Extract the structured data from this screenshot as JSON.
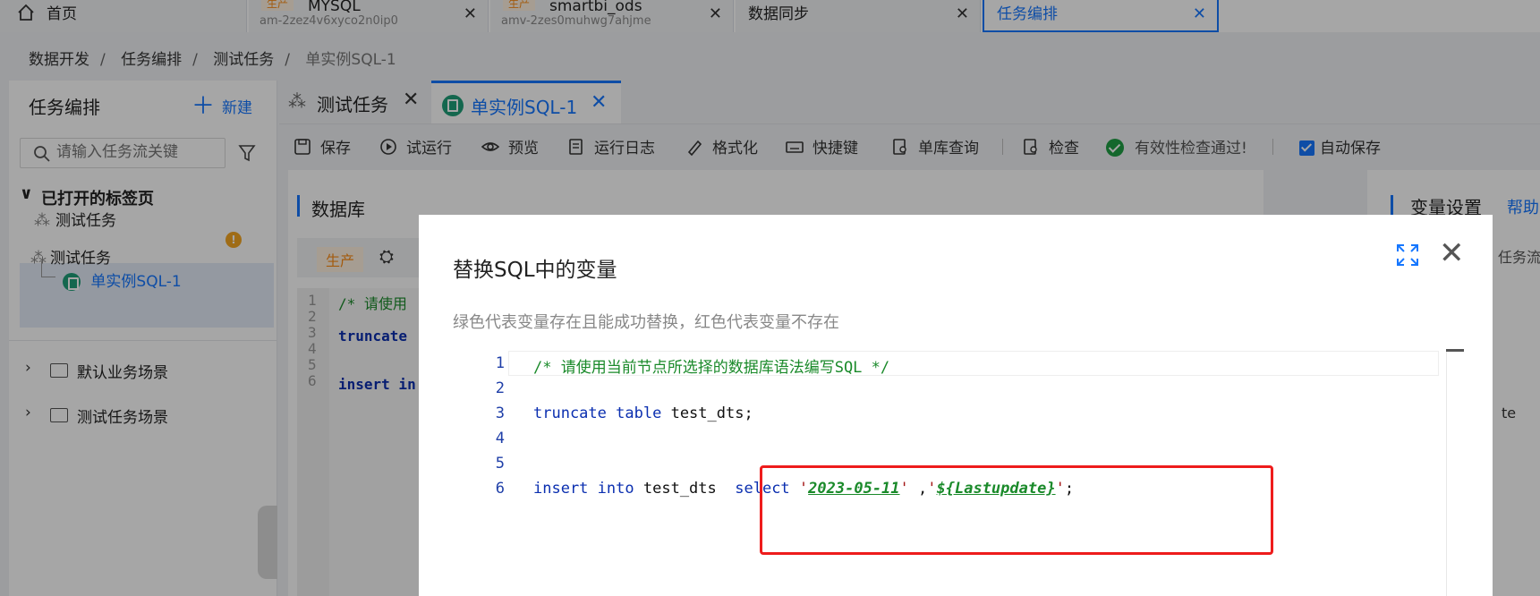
{
  "top_tabs": [
    {
      "title": "首页"
    },
    {
      "env": "生产",
      "title": "MYSQL",
      "subtitle": "am-2zez4v6xyco2n0ip0"
    },
    {
      "env": "生产",
      "title": "smartbi_ods",
      "subtitle": "amv-2zes0muhwg7ahjme"
    },
    {
      "title": "数据同步"
    },
    {
      "title": "任务编排"
    }
  ],
  "close_glyph": "✕",
  "breadcrumb": [
    "数据开发",
    "任务编排",
    "测试任务",
    "单实例SQL-1"
  ],
  "breadcrumb_sep": "/",
  "sidebar": {
    "title": "任务编排",
    "new_label": "新建",
    "search_placeholder": "请输入任务流关键",
    "open_tabs_label": "已打开的标签页",
    "items": [
      "测试任务",
      "测试任务",
      "单实例SQL-1"
    ],
    "warn_glyph": "!",
    "scenes": [
      "默认业务场景",
      "测试任务场景"
    ]
  },
  "main_tabs": [
    "测试任务",
    "单实例SQL-1"
  ],
  "toolbar": {
    "save": "保存",
    "trial_run": "试运行",
    "preview": "预览",
    "run_log": "运行日志",
    "format": "格式化",
    "shortcuts": "快捷键",
    "single_query": "单库查询",
    "check": "检查",
    "valid_msg": "有效性检查通过!",
    "autosave": "自动保存"
  },
  "content": {
    "title": "数据库",
    "env": "生产",
    "bg_lines": [
      "/* 请使用",
      "truncate",
      "insert in"
    ],
    "bg_line_numbers": [
      "1",
      "2",
      "3",
      "4",
      "5",
      "6"
    ]
  },
  "right_panel": {
    "title": "变量设置",
    "help": "帮助",
    "partial_text": "任务流",
    "partial_cell": "te"
  },
  "modal": {
    "title": "替换SQL中的变量",
    "hint": "绿色代表变量存在且能成功替换，红色代表变量不存在",
    "line_numbers": [
      "1",
      "2",
      "3",
      "4",
      "5",
      "6"
    ],
    "code": {
      "comment": "/* 请使用当前节点所选择的数据库语法编写SQL */",
      "l3_kw1": "truncate",
      "l3_kw2": "table",
      "l3_rest": "test_dts;",
      "l6_kw1": "insert",
      "l6_kw2": "into",
      "l6_table": "test_dts",
      "l6_kw3": "select",
      "q": "'",
      "var1": "2023-05-11",
      "comma": " ,",
      "var2": "${Lastupdate}",
      "semi": ";"
    }
  }
}
